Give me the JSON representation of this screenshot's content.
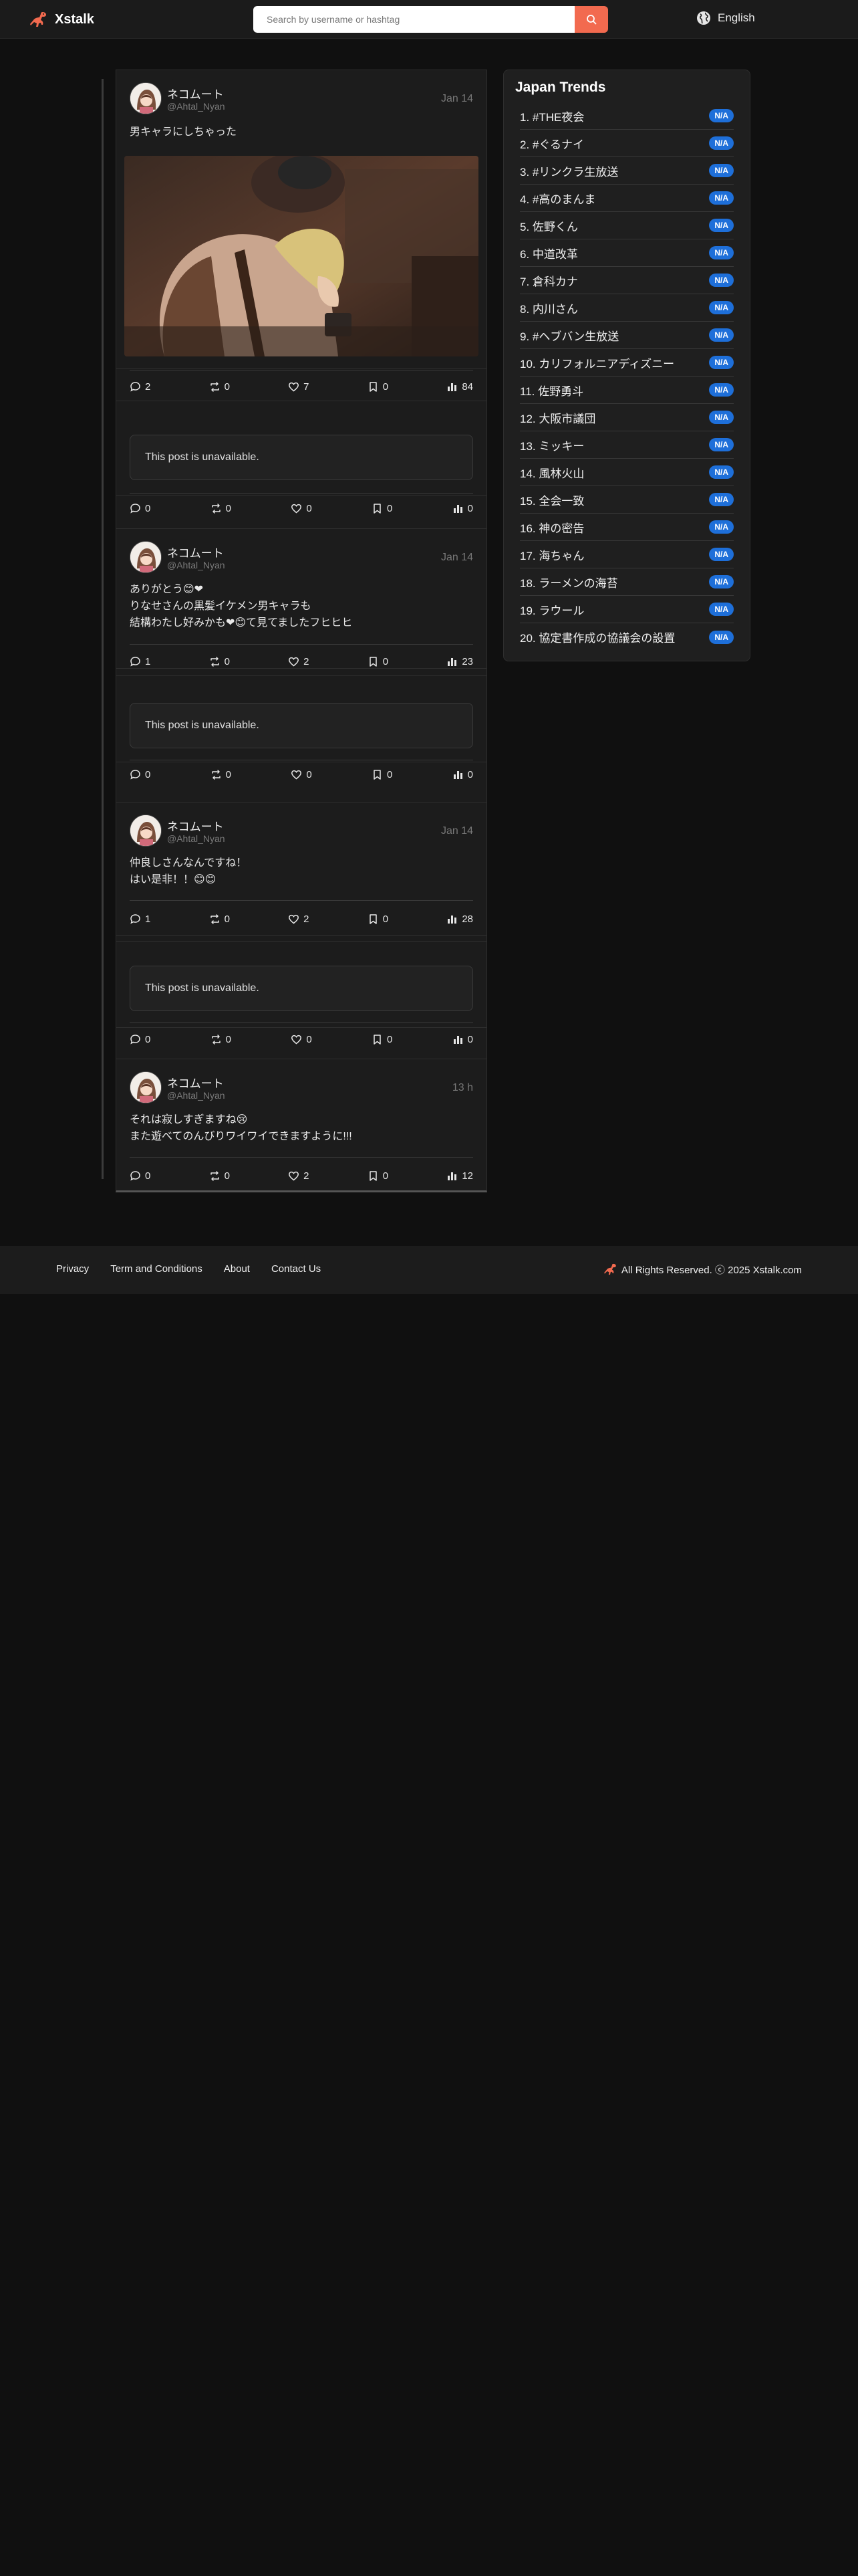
{
  "header": {
    "brand": "Xstalk",
    "search_placeholder": "Search by username or hashtag",
    "language": "English",
    "accent": "#f26a4f"
  },
  "posts": [
    {
      "type": "post",
      "name": "ネコムート",
      "handle": "@Ahtal_Nyan",
      "date": "Jan 14",
      "text": [
        "男キャラにしちゃった"
      ],
      "has_image": true,
      "stats": {
        "comments": "2",
        "reposts": "0",
        "likes": "7",
        "bookmarks": "0",
        "views": "84"
      }
    },
    {
      "type": "unavailable",
      "message": "This post is unavailable.",
      "stats": {
        "comments": "0",
        "reposts": "0",
        "likes": "0",
        "bookmarks": "0",
        "views": "0"
      }
    },
    {
      "type": "post",
      "name": "ネコムート",
      "handle": "@Ahtal_Nyan",
      "date": "Jan 14",
      "text": [
        "ありがとう😊❤",
        "りなせさんの黒髪イケメン男キャラも",
        "結構わたし好みかも❤😊て見てましたフヒヒヒ"
      ],
      "has_image": false,
      "stats": {
        "comments": "1",
        "reposts": "0",
        "likes": "2",
        "bookmarks": "0",
        "views": "23"
      }
    },
    {
      "type": "unavailable",
      "message": "This post is unavailable.",
      "stats": {
        "comments": "0",
        "reposts": "0",
        "likes": "0",
        "bookmarks": "0",
        "views": "0"
      }
    },
    {
      "type": "post",
      "name": "ネコムート",
      "handle": "@Ahtal_Nyan",
      "date": "Jan 14",
      "text": [
        "仲良しさんなんですね！",
        "はい是非！！😊😊"
      ],
      "has_image": false,
      "stats": {
        "comments": "1",
        "reposts": "0",
        "likes": "2",
        "bookmarks": "0",
        "views": "28"
      }
    },
    {
      "type": "unavailable",
      "message": "This post is unavailable.",
      "stats": {
        "comments": "0",
        "reposts": "0",
        "likes": "0",
        "bookmarks": "0",
        "views": "0"
      }
    },
    {
      "type": "post",
      "name": "ネコムート",
      "handle": "@Ahtal_Nyan",
      "date": "13 h",
      "text": [
        "それは寂しすぎますね😢",
        "また遊べてのんびりワイワイできますように!!!"
      ],
      "has_image": false,
      "stats": {
        "comments": "0",
        "reposts": "0",
        "likes": "2",
        "bookmarks": "0",
        "views": "12"
      }
    }
  ],
  "trends": {
    "title": "Japan Trends",
    "badge": "N/A",
    "badge_color": "#1e6fd9",
    "items": [
      "1. #THE夜会",
      "2. #ぐるナイ",
      "3. #リンクラ生放送",
      "4. #高のまんま",
      "5. 佐野くん",
      "6. 中道改革",
      "7. 倉科カナ",
      "8. 内川さん",
      "9. #ヘブバン生放送",
      "10. カリフォルニアディズニー",
      "11. 佐野勇斗",
      "12. 大阪市議団",
      "13. ミッキー",
      "14. 風林火山",
      "15. 全会一致",
      "16. 神の密告",
      "17. 海ちゃん",
      "18. ラーメンの海苔",
      "19. ラウール",
      "20. 協定書作成の協議会の設置"
    ]
  },
  "footer": {
    "links": [
      "Privacy",
      "Term and Conditions",
      "About",
      "Contact Us"
    ],
    "copyright": "All Rights Reserved. ⓒ 2025 Xstalk.com"
  }
}
